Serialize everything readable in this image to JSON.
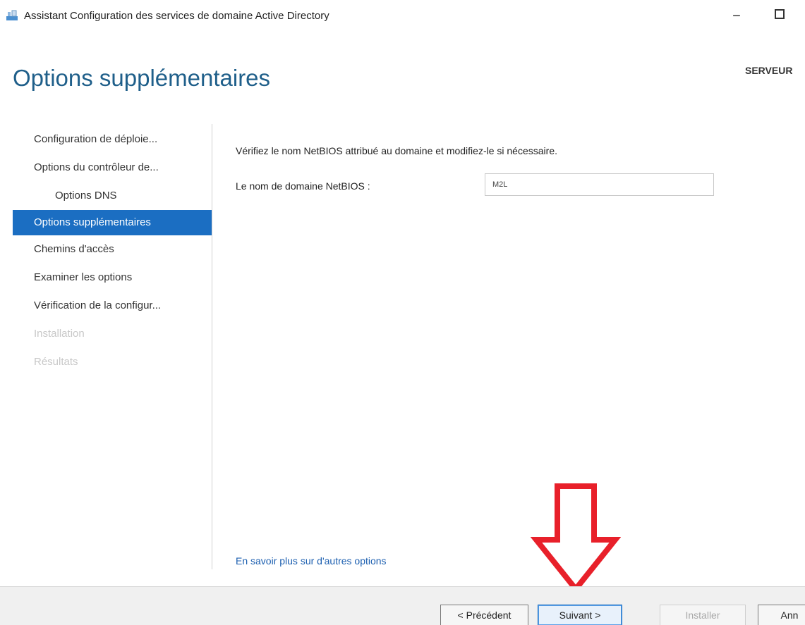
{
  "window": {
    "title": "Assistant Configuration des services de domaine Active Directory",
    "minimize_symbol": "−"
  },
  "header": {
    "page_title": "Options supplémentaires",
    "server": "SERVEUR"
  },
  "sidebar": {
    "items": [
      {
        "label": "Configuration de déploie...",
        "state": "normal"
      },
      {
        "label": "Options du contrôleur de...",
        "state": "normal"
      },
      {
        "label": "Options DNS",
        "state": "sub"
      },
      {
        "label": "Options supplémentaires",
        "state": "active"
      },
      {
        "label": "Chemins d'accès",
        "state": "normal"
      },
      {
        "label": "Examiner les options",
        "state": "normal"
      },
      {
        "label": "Vérification de la configur...",
        "state": "normal"
      },
      {
        "label": "Installation",
        "state": "disabled"
      },
      {
        "label": "Résultats",
        "state": "disabled"
      }
    ]
  },
  "main": {
    "description": "Vérifiez le nom NetBIOS attribué au domaine et modifiez-le si nécessaire.",
    "netbios_label": "Le nom de domaine NetBIOS :",
    "netbios_value": "M2L",
    "more_link": "En savoir plus sur d'autres options"
  },
  "footer": {
    "prev_label": "< Précédent",
    "next_label": "Suivant >",
    "install_label": "Installer",
    "cancel_label": "Ann"
  },
  "colors": {
    "accent": "#1b6ec2",
    "heading": "#1f5f8a",
    "annotation_arrow": "#e8202a",
    "disabled_text": "#c8c8c8"
  },
  "icons": {
    "window": "ad-wizard-icon",
    "annotation": "arrow-down-icon"
  }
}
